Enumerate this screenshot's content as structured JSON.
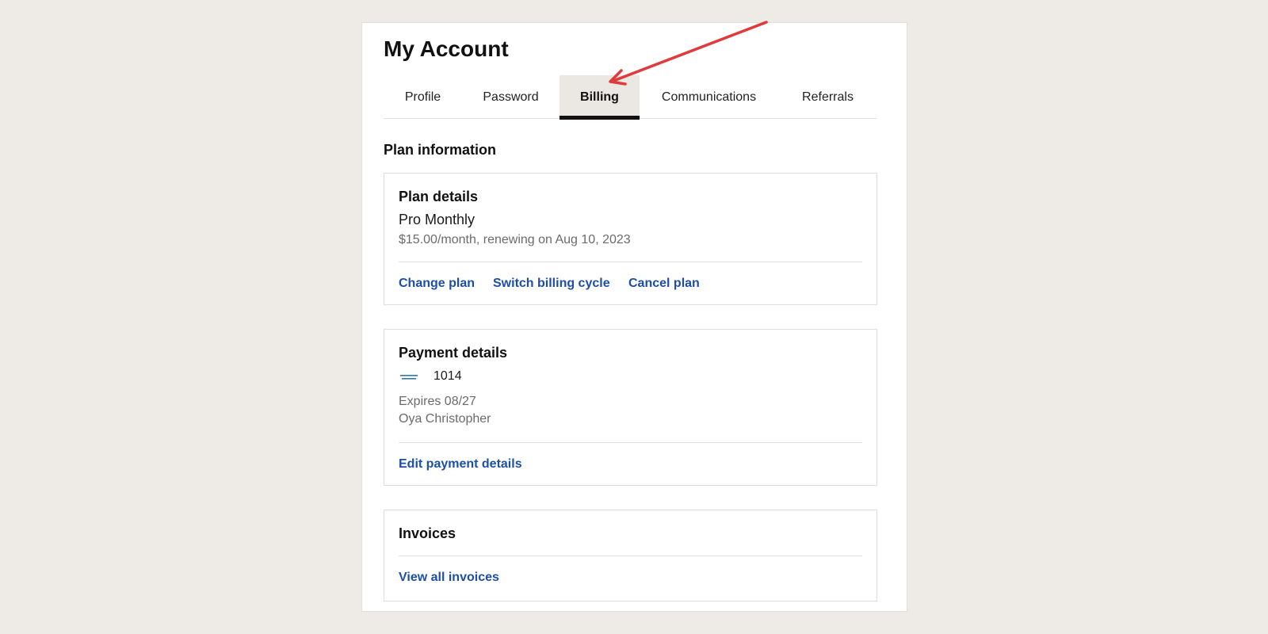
{
  "page": {
    "title": "My Account"
  },
  "tabs": [
    {
      "label": "Profile"
    },
    {
      "label": "Password"
    },
    {
      "label": "Billing",
      "active": true
    },
    {
      "label": "Communications"
    },
    {
      "label": "Referrals"
    }
  ],
  "plan_information": {
    "heading": "Plan information",
    "plan_details": {
      "title": "Plan details",
      "plan_name": "Pro Monthly",
      "price_line": "$15.00/month, renewing on Aug 10, 2023",
      "actions": {
        "change_plan": "Change plan",
        "switch_billing_cycle": "Switch billing cycle",
        "cancel_plan": "Cancel plan"
      }
    },
    "payment_details": {
      "title": "Payment details",
      "card_icon": "amex-card-icon",
      "card_last4": "1014",
      "expires": "Expires 08/27",
      "cardholder": "Oya Christopher",
      "edit_label": "Edit payment details"
    },
    "invoices": {
      "title": "Invoices",
      "view_all_label": "View all invoices"
    }
  },
  "colors": {
    "background": "#eeebe6",
    "link": "#1d4fa6",
    "active_tab_bg": "#ebe8e3",
    "annotation_arrow": "#e03a3a"
  }
}
